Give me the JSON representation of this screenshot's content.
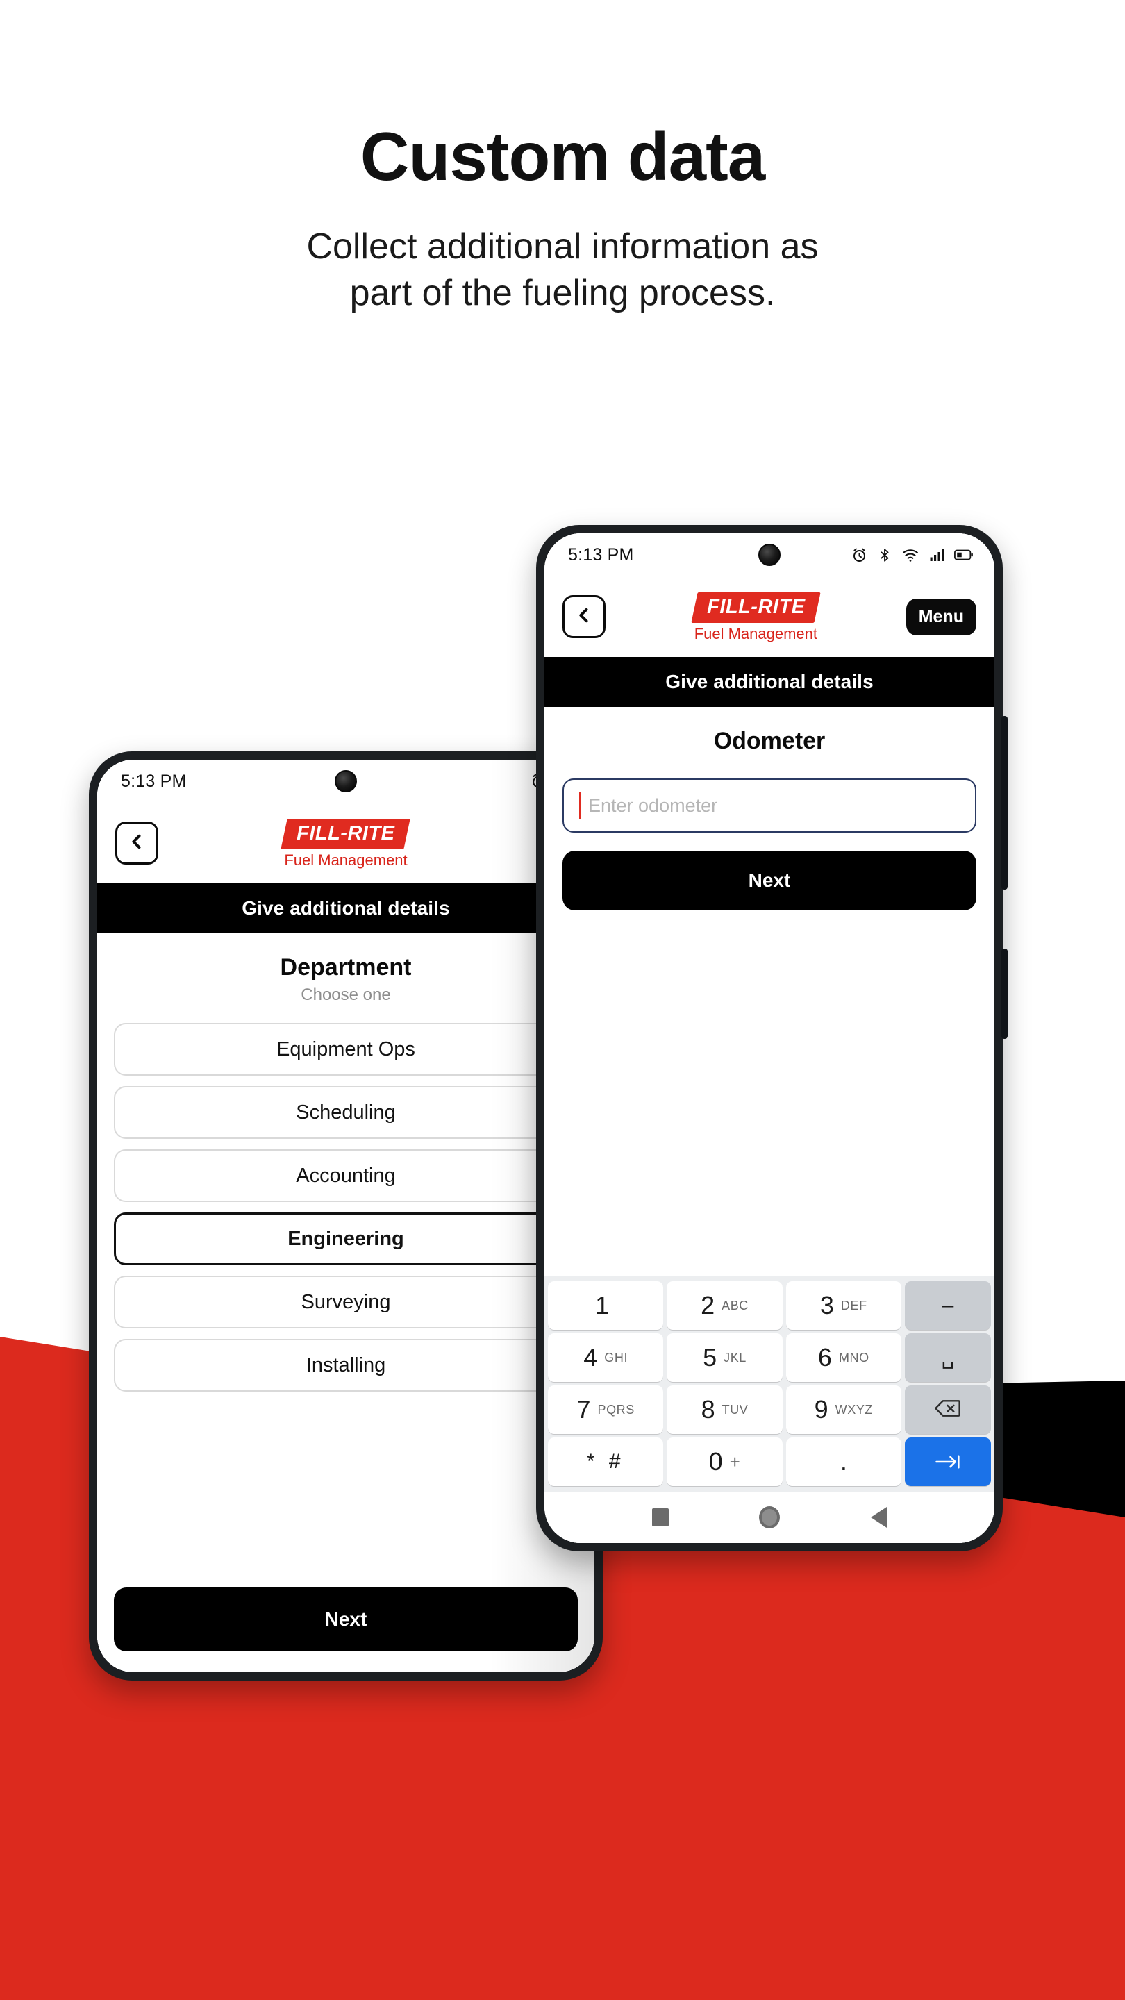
{
  "hero": {
    "title": "Custom data",
    "subtitle_line1": "Collect additional information as",
    "subtitle_line2": "part of the fueling process."
  },
  "colors": {
    "brand_red": "#E02B20",
    "background_red": "#DC2A1E",
    "background_black": "#000000",
    "accent_blue": "#1b72e8",
    "input_border": "#2b3a63",
    "caret_red": "#E02B20"
  },
  "phone_back": {
    "status_bar": {
      "time": "5:13 PM",
      "icons": [
        "alarm-icon",
        "bluetooth-icon"
      ]
    },
    "header": {
      "back_icon": "chevron-left-icon",
      "brand_name": "FILL-RITE",
      "brand_tagline": "Fuel Management"
    },
    "section_title": "Give additional details",
    "field": {
      "label": "Department",
      "hint": "Choose one"
    },
    "options": [
      {
        "label": "Equipment Ops",
        "selected": false
      },
      {
        "label": "Scheduling",
        "selected": false
      },
      {
        "label": "Accounting",
        "selected": false
      },
      {
        "label": "Engineering",
        "selected": true
      },
      {
        "label": "Surveying",
        "selected": false
      },
      {
        "label": "Installing",
        "selected": false
      }
    ],
    "next_label": "Next"
  },
  "phone_front": {
    "status_bar": {
      "time": "5:13 PM",
      "icons": [
        "alarm-icon",
        "bluetooth-icon",
        "wifi-icon",
        "signal-icon",
        "battery-icon"
      ]
    },
    "header": {
      "back_icon": "chevron-left-icon",
      "brand_name": "FILL-RITE",
      "brand_tagline": "Fuel Management",
      "menu_label": "Menu"
    },
    "section_title": "Give additional details",
    "field": {
      "label": "Odometer",
      "placeholder": "Enter odometer",
      "value": ""
    },
    "next_label": "Next",
    "keyboard": {
      "rows": [
        [
          {
            "num": "1",
            "sub": ""
          },
          {
            "num": "2",
            "sub": "ABC"
          },
          {
            "num": "3",
            "sub": "DEF"
          },
          {
            "num": "–",
            "sub": "",
            "type": "fn"
          }
        ],
        [
          {
            "num": "4",
            "sub": "GHI"
          },
          {
            "num": "5",
            "sub": "JKL"
          },
          {
            "num": "6",
            "sub": "MNO"
          },
          {
            "num": "␣",
            "sub": "",
            "type": "fn"
          }
        ],
        [
          {
            "num": "7",
            "sub": "PQRS"
          },
          {
            "num": "8",
            "sub": "TUV"
          },
          {
            "num": "9",
            "sub": "WXYZ"
          },
          {
            "num": "",
            "sub": "",
            "type": "backspace"
          }
        ],
        [
          {
            "num": "* #",
            "sub": "",
            "type": "sym"
          },
          {
            "num": "0",
            "sub": "+"
          },
          {
            "num": ".",
            "sub": ""
          },
          {
            "num": "",
            "sub": "",
            "type": "enter"
          }
        ]
      ]
    },
    "nav_bar": {
      "recents_icon": "square-icon",
      "home_icon": "circle-icon",
      "back_icon": "triangle-left-icon"
    }
  }
}
